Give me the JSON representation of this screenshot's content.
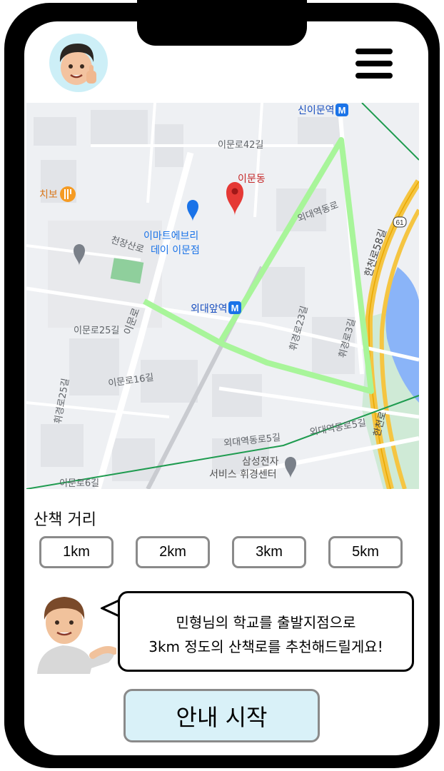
{
  "map": {
    "labels": [
      {
        "text": "신이문역"
      },
      {
        "text": "이문동"
      },
      {
        "text": "치보"
      },
      {
        "text": "이마트에브리"
      },
      {
        "text": "데이 이문점"
      },
      {
        "text": "외대앞역"
      },
      {
        "text": "외대역동로"
      },
      {
        "text": "천장산로"
      },
      {
        "text": "이문로"
      },
      {
        "text": "이문로25길"
      },
      {
        "text": "이문로16길"
      },
      {
        "text": "이문로42길"
      },
      {
        "text": "한천로58길"
      },
      {
        "text": "한천로"
      },
      {
        "text": "외대역동로5길"
      },
      {
        "text": "외대역동로5길"
      },
      {
        "text": "삼성전자"
      },
      {
        "text": "서비스 휘경센터"
      },
      {
        "text": "휘경로23길"
      },
      {
        "text": "휘경로3길"
      },
      {
        "text": "휘경로25길"
      },
      {
        "text": "이문로6길"
      },
      {
        "text": "61"
      }
    ]
  },
  "distance": {
    "title": "산책 거리",
    "options": [
      "1km",
      "2km",
      "3km",
      "5km"
    ]
  },
  "guide": {
    "line1": "민형님의 학교를 출발지점으로",
    "line2": "3km 정도의 산책로를 추천해드릴게요!"
  },
  "start_button": "안내 시작",
  "colors": {
    "route": "#a8f59a",
    "accent_bg": "#d9f1f8",
    "river": "#8ab4f8",
    "highway": "#f5c542",
    "pin": "#e53935",
    "station": "#1a73e8"
  }
}
